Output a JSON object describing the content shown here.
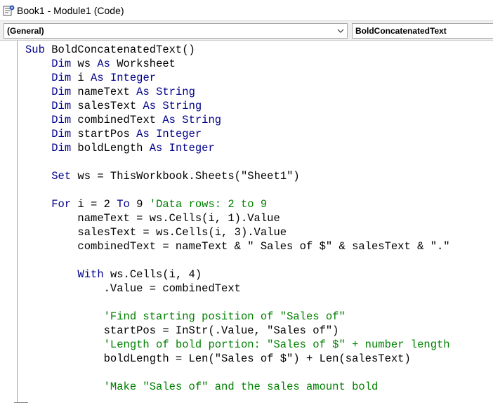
{
  "window": {
    "title": "Book1 - Module1 (Code)"
  },
  "toolbar": {
    "object_combo": "(General)",
    "procedure_combo": "BoldConcatenatedText"
  },
  "colors": {
    "keyword": "#00008b",
    "comment": "#008000",
    "text": "#000000"
  },
  "icons": [
    "vba-module-icon",
    "chevron-down-icon"
  ],
  "code_lines": [
    [
      {
        "t": "kw",
        "v": "Sub"
      },
      {
        "t": "plain",
        "v": " BoldConcatenatedText()"
      }
    ],
    [
      {
        "t": "plain",
        "v": "    "
      },
      {
        "t": "kw",
        "v": "Dim"
      },
      {
        "t": "plain",
        "v": " ws "
      },
      {
        "t": "kw",
        "v": "As"
      },
      {
        "t": "plain",
        "v": " Worksheet"
      }
    ],
    [
      {
        "t": "plain",
        "v": "    "
      },
      {
        "t": "kw",
        "v": "Dim"
      },
      {
        "t": "plain",
        "v": " i "
      },
      {
        "t": "kw",
        "v": "As"
      },
      {
        "t": "plain",
        "v": " "
      },
      {
        "t": "kw",
        "v": "Integer"
      }
    ],
    [
      {
        "t": "plain",
        "v": "    "
      },
      {
        "t": "kw",
        "v": "Dim"
      },
      {
        "t": "plain",
        "v": " nameText "
      },
      {
        "t": "kw",
        "v": "As"
      },
      {
        "t": "plain",
        "v": " "
      },
      {
        "t": "kw",
        "v": "String"
      }
    ],
    [
      {
        "t": "plain",
        "v": "    "
      },
      {
        "t": "kw",
        "v": "Dim"
      },
      {
        "t": "plain",
        "v": " salesText "
      },
      {
        "t": "kw",
        "v": "As"
      },
      {
        "t": "plain",
        "v": " "
      },
      {
        "t": "kw",
        "v": "String"
      }
    ],
    [
      {
        "t": "plain",
        "v": "    "
      },
      {
        "t": "kw",
        "v": "Dim"
      },
      {
        "t": "plain",
        "v": " combinedText "
      },
      {
        "t": "kw",
        "v": "As"
      },
      {
        "t": "plain",
        "v": " "
      },
      {
        "t": "kw",
        "v": "String"
      }
    ],
    [
      {
        "t": "plain",
        "v": "    "
      },
      {
        "t": "kw",
        "v": "Dim"
      },
      {
        "t": "plain",
        "v": " startPos "
      },
      {
        "t": "kw",
        "v": "As"
      },
      {
        "t": "plain",
        "v": " "
      },
      {
        "t": "kw",
        "v": "Integer"
      }
    ],
    [
      {
        "t": "plain",
        "v": "    "
      },
      {
        "t": "kw",
        "v": "Dim"
      },
      {
        "t": "plain",
        "v": " boldLength "
      },
      {
        "t": "kw",
        "v": "As"
      },
      {
        "t": "plain",
        "v": " "
      },
      {
        "t": "kw",
        "v": "Integer"
      }
    ],
    [],
    [
      {
        "t": "plain",
        "v": "    "
      },
      {
        "t": "kw",
        "v": "Set"
      },
      {
        "t": "plain",
        "v": " ws = ThisWorkbook.Sheets(\"Sheet1\")"
      }
    ],
    [],
    [
      {
        "t": "plain",
        "v": "    "
      },
      {
        "t": "kw",
        "v": "For"
      },
      {
        "t": "plain",
        "v": " i = 2 "
      },
      {
        "t": "kw",
        "v": "To"
      },
      {
        "t": "plain",
        "v": " 9 "
      },
      {
        "t": "cm",
        "v": "'Data rows: 2 to 9"
      }
    ],
    [
      {
        "t": "plain",
        "v": "        nameText = ws.Cells(i, 1).Value"
      }
    ],
    [
      {
        "t": "plain",
        "v": "        salesText = ws.Cells(i, 3).Value"
      }
    ],
    [
      {
        "t": "plain",
        "v": "        combinedText = nameText & \" Sales of $\" & salesText & \".\""
      }
    ],
    [],
    [
      {
        "t": "plain",
        "v": "        "
      },
      {
        "t": "kw",
        "v": "With"
      },
      {
        "t": "plain",
        "v": " ws.Cells(i, 4)"
      }
    ],
    [
      {
        "t": "plain",
        "v": "            .Value = combinedText"
      }
    ],
    [],
    [
      {
        "t": "plain",
        "v": "            "
      },
      {
        "t": "cm",
        "v": "'Find starting position of \"Sales of\""
      }
    ],
    [
      {
        "t": "plain",
        "v": "            startPos = InStr(.Value, \"Sales of\")"
      }
    ],
    [
      {
        "t": "plain",
        "v": "            "
      },
      {
        "t": "cm",
        "v": "'Length of bold portion: \"Sales of $\" + number length"
      }
    ],
    [
      {
        "t": "plain",
        "v": "            boldLength = Len(\"Sales of $\") + Len(salesText)"
      }
    ],
    [],
    [
      {
        "t": "plain",
        "v": "            "
      },
      {
        "t": "cm",
        "v": "'Make \"Sales of\" and the sales amount bold"
      }
    ]
  ]
}
